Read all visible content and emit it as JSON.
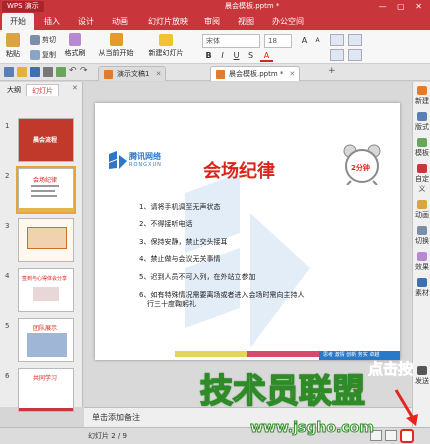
{
  "titlebar": {
    "app_name": "WPS 演示",
    "doc_title": "晨会模板.pptm *"
  },
  "menu": {
    "tabs": [
      "开始",
      "插入",
      "设计",
      "动画",
      "幻灯片放映",
      "审阅",
      "视图",
      "办公空间"
    ]
  },
  "ribbon": {
    "paste": "粘贴",
    "cut": "剪切",
    "copy": "复制",
    "format_painter": "格式刷",
    "from_current": "从当前开始",
    "new_slide": "新建幻灯片",
    "font_name": "宋体",
    "font_size": "18",
    "bold": "B",
    "italic": "I",
    "underline": "U",
    "shadow": "S",
    "grow_font": "A",
    "shrink_font": "A",
    "font_color": "A"
  },
  "doc_tabs": [
    {
      "label": "演示文稿1"
    },
    {
      "label": "晨会模板.pptm *"
    }
  ],
  "left_panel": {
    "tab_outline": "大纲",
    "tab_slides": "幻灯片",
    "slide_numbers": [
      "1",
      "2",
      "3",
      "4",
      "5",
      "6"
    ],
    "thumb_text": [
      "晨会流程",
      "会场纪律",
      "",
      "签到与心得体会分享",
      "团队展示",
      "共同学习"
    ]
  },
  "slide": {
    "logo_name": "腾讯网络",
    "logo_sub": "RONGXUN",
    "title": "会场纪律",
    "clock_label": "2分钟",
    "bullets": [
      "1、请将手机调至无声状态",
      "2、不得接听电话",
      "3、保持安静，禁止交头接耳",
      "4、禁止做与会议无关事情",
      "5、迟到人员不可入列，在外站立参加",
      "6、如有特殊情况需要离场或者进入会场时需向主持人",
      "行三十度鞠躬礼"
    ],
    "footer_text": "思考 激情 创新 务实 卓越"
  },
  "notes": {
    "placeholder": "单击添加备注"
  },
  "statusbar": {
    "slide_counter": "幻灯片 2 / 9"
  },
  "right_sidebar": {
    "items": [
      "新建",
      "版式",
      "模板",
      "自定义",
      "动画",
      "切换",
      "效果",
      "素材",
      "发送"
    ]
  },
  "overlay": {
    "hint": "点击按",
    "watermark": "技术员联盟",
    "watermark_url": "www.jsgho.com"
  },
  "colors": {
    "accent": "#c8353a",
    "slide_title": "#d9251c",
    "logo_blue": "#2a78c8",
    "watermark_green": "#2e8b27",
    "hint_red": "#e8241f"
  }
}
